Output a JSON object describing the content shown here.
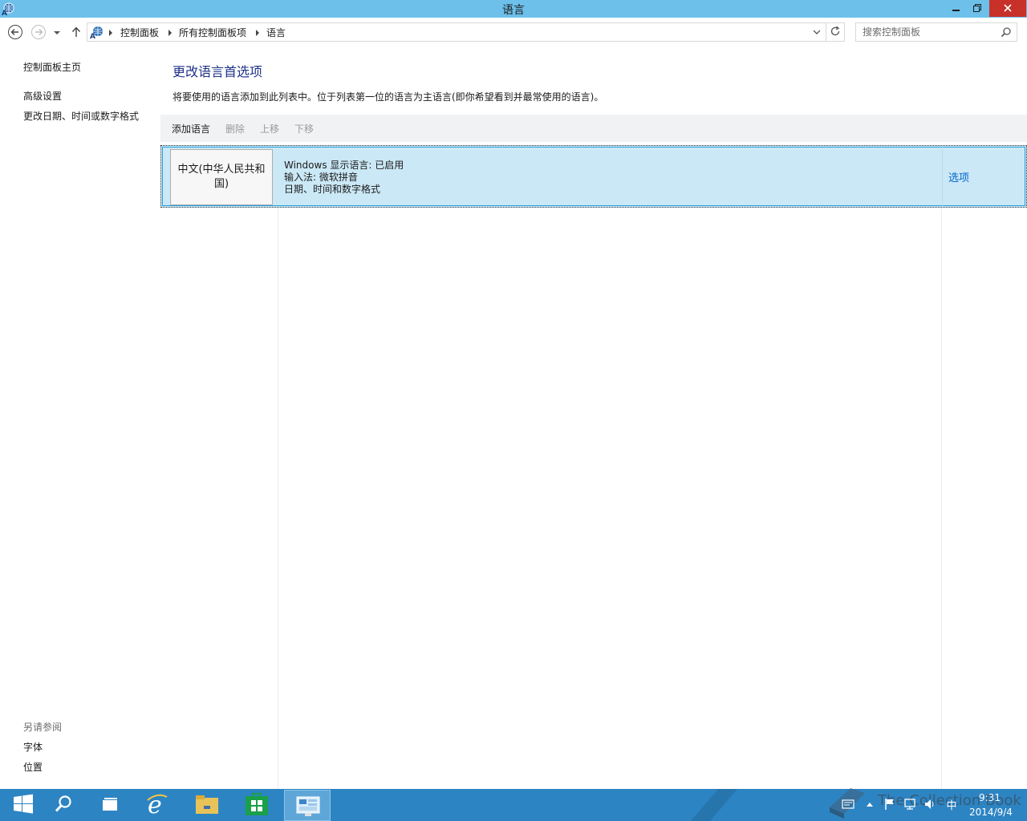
{
  "window": {
    "title": "语言"
  },
  "nav": {
    "breadcrumbs": [
      "控制面板",
      "所有控制面板项",
      "语言"
    ],
    "search_placeholder": "搜索控制面板"
  },
  "sidebar": {
    "links": [
      "控制面板主页",
      "高级设置",
      "更改日期、时间或数字格式"
    ],
    "see_also_heading": "另请参阅",
    "see_also_links": [
      "字体",
      "位置"
    ]
  },
  "main": {
    "title": "更改语言首选项",
    "description": "将要使用的语言添加到此列表中。位于列表第一位的语言为主语言(即你希望看到并最常使用的语言)。",
    "toolbar": {
      "add_label": "添加语言",
      "remove_label": "删除",
      "up_label": "上移",
      "down_label": "下移"
    },
    "languages": [
      {
        "name": "中文(中华人民共和国)",
        "details": [
          "Windows 显示语言: 已启用",
          "输入法: 微软拼音",
          "日期、时间和数字格式"
        ],
        "options_label": "选项"
      }
    ]
  },
  "taskbar": {
    "ime_indicator": "中",
    "time": "9:31",
    "date": "2014/9/4",
    "watermark": "The Collection Book"
  },
  "colors": {
    "titlebar": "#6cc0ea",
    "close_button": "#c7312a",
    "taskbar": "#2d84c3",
    "selection": "#cbe8f6",
    "link": "#1e3287"
  }
}
